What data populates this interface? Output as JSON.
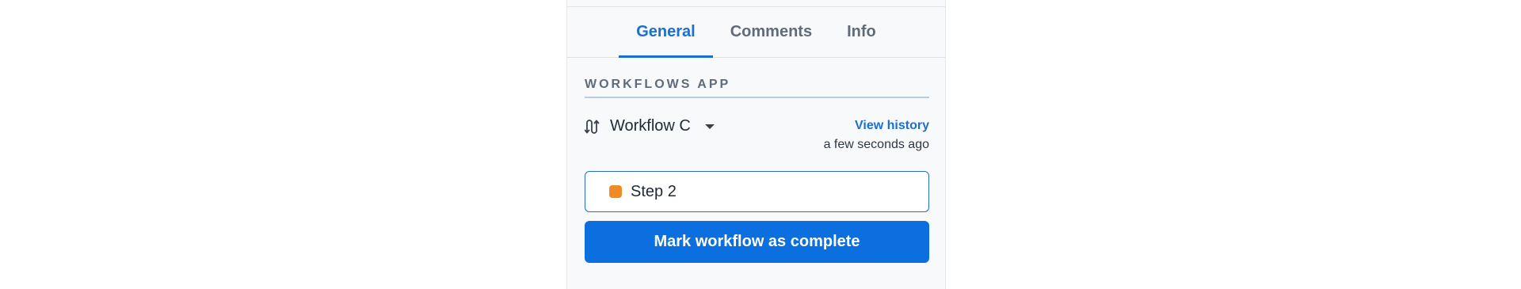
{
  "tabs": [
    {
      "label": "General",
      "active": true
    },
    {
      "label": "Comments",
      "active": false
    },
    {
      "label": "Info",
      "active": false
    }
  ],
  "section": {
    "heading": "WORKFLOWS APP"
  },
  "workflow": {
    "icon": "workflow-icon",
    "name": "Workflow C",
    "dropdown_icon": "chevron-down-icon",
    "view_history_label": "View history",
    "last_updated": "a few seconds ago"
  },
  "step": {
    "label": "Step 2",
    "status_color": "#f08a24"
  },
  "actions": {
    "complete_label": "Mark workflow as complete"
  },
  "colors": {
    "accent": "#1a6fd0",
    "button": "#0b6fe0",
    "panel_bg": "#f8f9fa"
  }
}
